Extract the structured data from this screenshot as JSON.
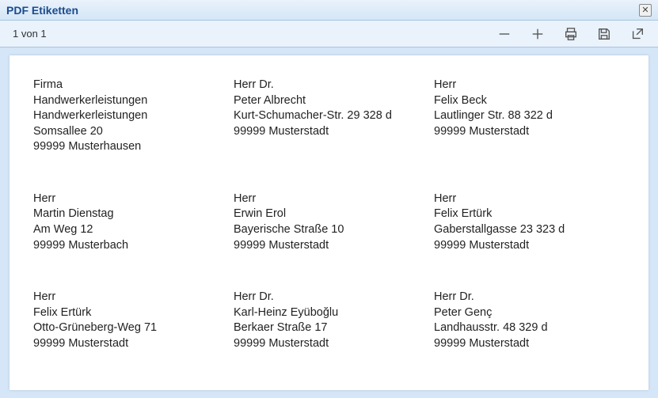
{
  "window": {
    "title": "PDF Etiketten"
  },
  "toolbar": {
    "page_indicator": "1 von 1"
  },
  "labels": [
    {
      "lines": [
        "Firma",
        "Handwerkerleistungen",
        "Handwerkerleistungen",
        "Somsallee 20",
        "99999 Musterhausen"
      ]
    },
    {
      "lines": [
        "Herr  Dr.",
        "Peter Albrecht",
        "Kurt-Schumacher-Str. 29 328 d",
        "99999 Musterstadt"
      ]
    },
    {
      "lines": [
        "Herr",
        "Felix Beck",
        "Lautlinger Str. 88 322 d",
        "99999 Musterstadt"
      ]
    },
    {
      "lines": [
        "Herr",
        "Martin Dienstag",
        "Am Weg 12",
        "99999 Musterbach"
      ]
    },
    {
      "lines": [
        "Herr",
        "Erwin Erol",
        "Bayerische Straße 10",
        "99999 Musterstadt"
      ]
    },
    {
      "lines": [
        "Herr",
        "Felix Ertürk",
        "Gaberstallgasse 23 323 d",
        "99999 Musterstadt"
      ]
    },
    {
      "lines": [
        "Herr",
        "Felix Ertürk",
        "Otto-Grüneberg-Weg 71",
        "99999 Musterstadt"
      ]
    },
    {
      "lines": [
        "Herr  Dr.",
        "Karl-Heinz Eyüboğlu",
        "Berkaer Straße 17",
        "99999 Musterstadt"
      ]
    },
    {
      "lines": [
        "Herr  Dr.",
        "Peter Genç",
        "Landhausstr. 48 329 d",
        "99999 Musterstadt"
      ]
    }
  ]
}
